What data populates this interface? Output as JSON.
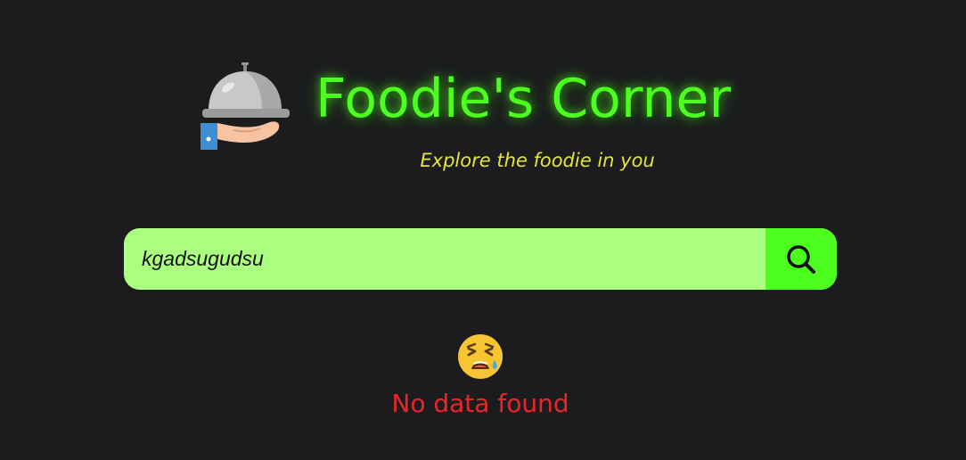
{
  "header": {
    "title": "Foodie's Corner",
    "subtitle": "Explore the foodie in you",
    "logo_icon": "serving-cloche-hand-icon"
  },
  "search": {
    "value": "kgadsugudsu",
    "button_icon": "search-icon"
  },
  "results": {
    "empty_icon": "weary-crying-face-icon",
    "empty_message": "No data found"
  },
  "colors": {
    "background": "#1c1c1e",
    "title_green": "#4cff1f",
    "subtitle_yellow": "#e4e53a",
    "input_bg": "#aaff7f",
    "button_bg": "#4cff1f",
    "error_red": "#e8262a"
  }
}
